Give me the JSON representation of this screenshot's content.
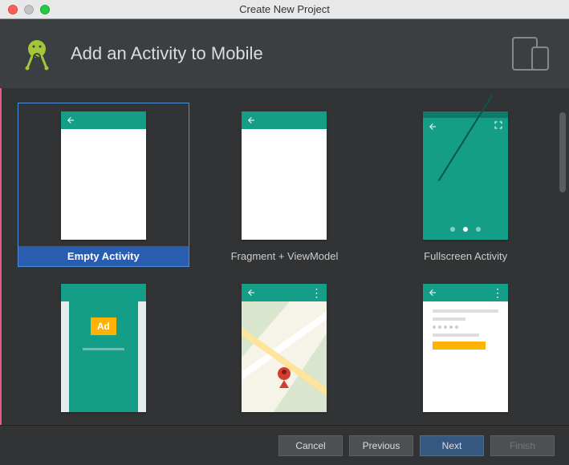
{
  "window": {
    "title": "Create New Project"
  },
  "header": {
    "title": "Add an Activity to Mobile"
  },
  "activities": [
    {
      "label": "Empty Activity",
      "selected": true,
      "kind": "empty"
    },
    {
      "label": "Fragment + ViewModel",
      "selected": false,
      "kind": "empty"
    },
    {
      "label": "Fullscreen Activity",
      "selected": false,
      "kind": "fullscreen"
    },
    {
      "label": "",
      "selected": false,
      "kind": "ad"
    },
    {
      "label": "",
      "selected": false,
      "kind": "map"
    },
    {
      "label": "",
      "selected": false,
      "kind": "detail"
    }
  ],
  "ad_text": "Ad",
  "footer": {
    "cancel": "Cancel",
    "previous": "Previous",
    "next": "Next",
    "finish": "Finish"
  }
}
